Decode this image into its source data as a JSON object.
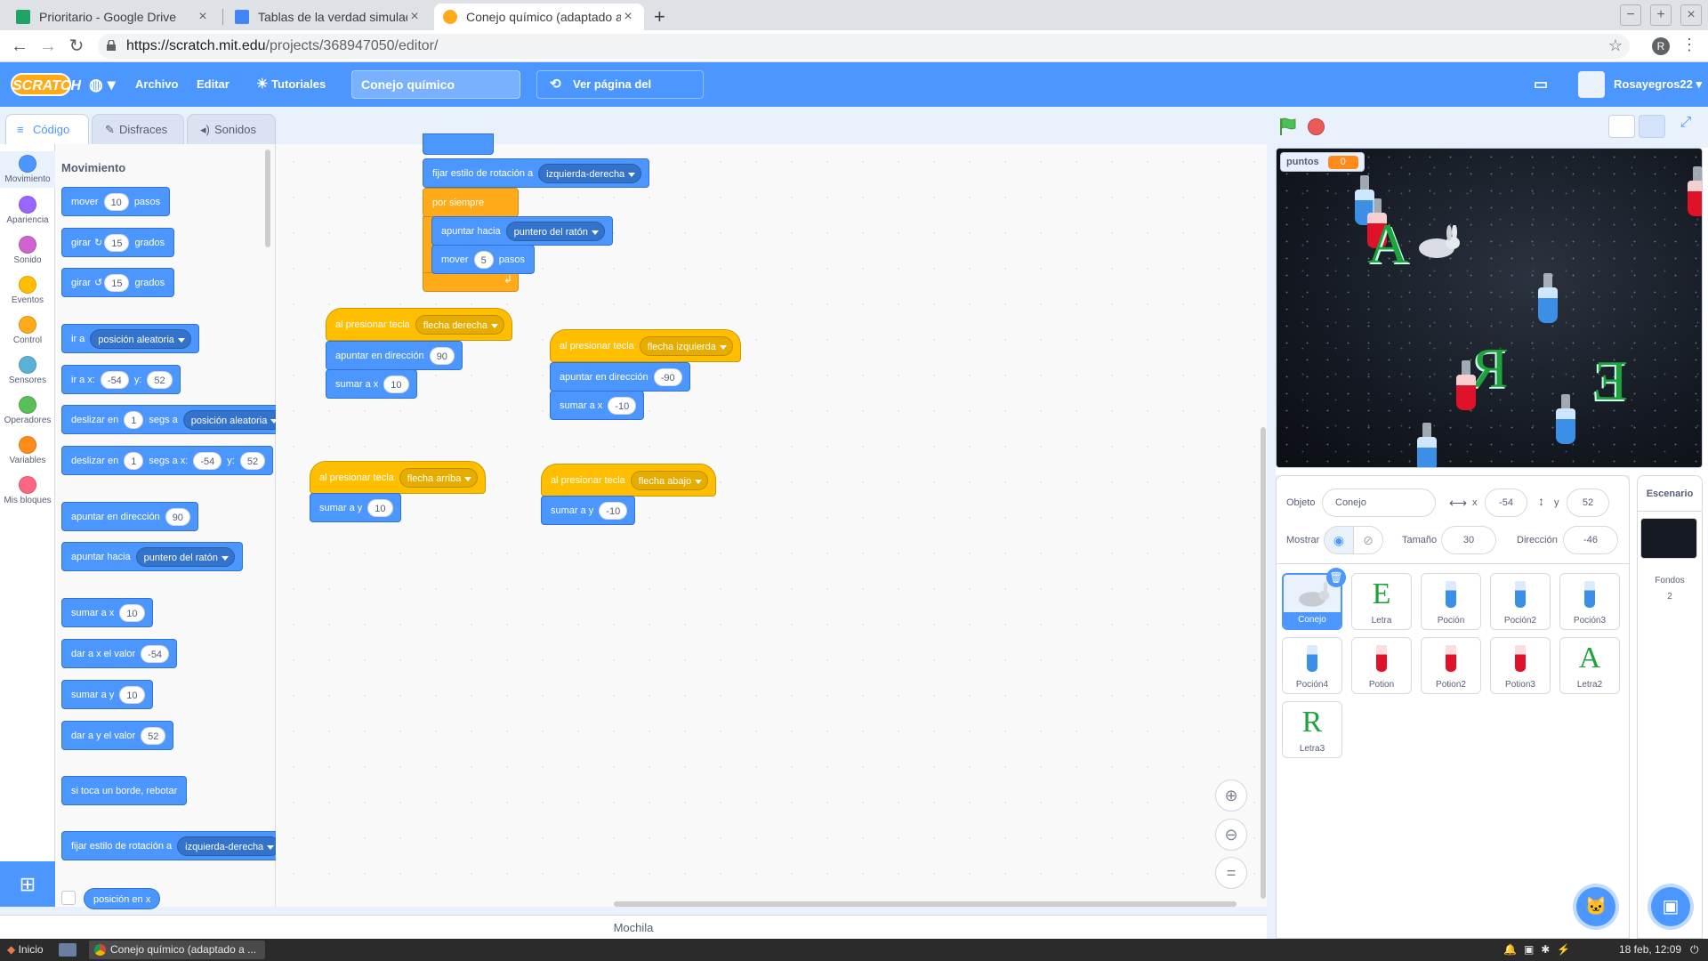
{
  "browser": {
    "tabs": [
      {
        "title": "Prioritario - Google Drive",
        "color": "#1fa463"
      },
      {
        "title": "Tablas de la verdad simulador...",
        "color": "#4285f4"
      },
      {
        "title": "Conejo químico (adaptado a ta...",
        "color": "#ffab19"
      }
    ],
    "url_host": "https://scratch.mit.edu",
    "url_path": "/projects/368947050/editor/",
    "profile_initial": "R"
  },
  "menubar": {
    "logo": "SCRATCH",
    "archivo": "Archivo",
    "editar": "Editar",
    "tutoriales": "Tutoriales",
    "project_title": "Conejo químico (adaptado...",
    "see_project": "Ver página del proyecto",
    "username": "Rosayegros22"
  },
  "editor_tabs": {
    "code": "Código",
    "costumes": "Disfraces",
    "sounds": "Sonidos"
  },
  "categories": [
    {
      "label": "Movimiento",
      "color": "#4c97ff"
    },
    {
      "label": "Apariencia",
      "color": "#9966ff"
    },
    {
      "label": "Sonido",
      "color": "#cf63cf"
    },
    {
      "label": "Eventos",
      "color": "#ffbf00"
    },
    {
      "label": "Control",
      "color": "#ffab19"
    },
    {
      "label": "Sensores",
      "color": "#5cb1d6"
    },
    {
      "label": "Operadores",
      "color": "#59c059"
    },
    {
      "label": "Variables",
      "color": "#ff8c1a"
    },
    {
      "label": "Mis bloques",
      "color": "#ff6680"
    }
  ],
  "palette": {
    "heading": "Movimiento",
    "mover": "mover",
    "mover_val": "10",
    "pasos": "pasos",
    "girar": "girar",
    "girar_val": "15",
    "grados": "grados",
    "ir_a": "ir a",
    "posicion_aleatoria": "posición aleatoria",
    "ir_a_x": "ir a x:",
    "x_val": "-54",
    "y": "y:",
    "y_val": "52",
    "deslizar_en": "deslizar en",
    "one": "1",
    "segs_a": "segs a",
    "segs_a_x": "segs a x:",
    "apuntar_en_direccion": "apuntar en dirección",
    "dir_val": "90",
    "apuntar_hacia": "apuntar hacia",
    "puntero_del_raton": "puntero del ratón",
    "sumar_a_x": "sumar a x",
    "sumar_x_val": "10",
    "dar_a_x": "dar a x el valor",
    "dar_x_val": "-54",
    "sumar_a_y": "sumar a y",
    "sumar_y_val": "10",
    "dar_a_y": "dar a y el valor",
    "dar_y_val": "52",
    "si_toca_borde": "si toca un borde, rebotar",
    "fijar_estilo": "fijar estilo de rotación a",
    "izquierda_derecha": "izquierda-derecha",
    "posicion_en_x": "posición en x"
  },
  "scripts": {
    "fijar_estilo": "fijar estilo de rotación a",
    "izquierda_derecha": "izquierda-derecha",
    "por_siempre": "por siempre",
    "apuntar_hacia": "apuntar hacia",
    "puntero_del_raton": "puntero del ratón",
    "mover": "mover",
    "mover_val": "5",
    "pasos": "pasos",
    "al_presionar_tecla": "al presionar tecla",
    "flecha_derecha": "flecha derecha",
    "flecha_izquierda": "flecha izquierda",
    "flecha_arriba": "flecha arriba",
    "flecha_abajo": "flecha abajo",
    "apuntar_en_direccion": "apuntar en dirección",
    "dir_right": "90",
    "dir_left": "-90",
    "sumar_a_x": "sumar a x",
    "x_right": "10",
    "x_left": "-10",
    "sumar_a_y": "sumar a y",
    "y_up": "10",
    "y_down": "-10"
  },
  "backpack": "Mochila",
  "stage": {
    "monitor_label": "puntos",
    "monitor_value": "0",
    "letters": [
      "A",
      "R",
      "E"
    ]
  },
  "sprite_info": {
    "objeto_label": "Objeto",
    "name": "Conejo",
    "x_label": "x",
    "x": "-54",
    "y_label": "y",
    "y": "52",
    "mostrar_label": "Mostrar",
    "size_label": "Tamaño",
    "size": "30",
    "direction_label": "Dirección",
    "direction": "-46"
  },
  "sprites": [
    {
      "name": "Conejo",
      "kind": "bunny"
    },
    {
      "name": "Letra",
      "kind": "letter",
      "glyph": "E"
    },
    {
      "name": "Poción",
      "kind": "blue"
    },
    {
      "name": "Poción2",
      "kind": "blue"
    },
    {
      "name": "Poción3",
      "kind": "blue"
    },
    {
      "name": "Poción4",
      "kind": "blue"
    },
    {
      "name": "Potion",
      "kind": "red"
    },
    {
      "name": "Potion2",
      "kind": "red"
    },
    {
      "name": "Potion3",
      "kind": "red"
    },
    {
      "name": "Letra2",
      "kind": "letter",
      "glyph": "A"
    },
    {
      "name": "Letra3",
      "kind": "letter",
      "glyph": "R"
    }
  ],
  "stage_pane": {
    "title": "Escenario",
    "backdrops_label": "Fondos",
    "backdrops_count": "2"
  },
  "taskbar": {
    "start": "Inicio",
    "task": "Conejo químico (adaptado a ...",
    "clock": "18 feb, 12:09"
  }
}
